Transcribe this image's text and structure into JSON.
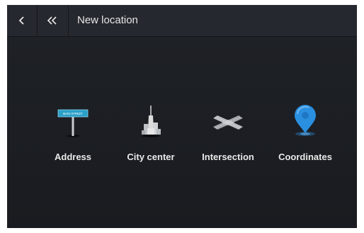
{
  "header": {
    "back_icon": "chevron-left-icon",
    "home_icon": "double-chevron-left-icon",
    "title": "New location"
  },
  "options": [
    {
      "label": "Address",
      "icon": "street-sign-icon",
      "sign_text": "MAIN STREET"
    },
    {
      "label": "City center",
      "icon": "city-tower-icon"
    },
    {
      "label": "Intersection",
      "icon": "crossroads-icon"
    },
    {
      "label": "Coordinates",
      "icon": "map-pin-icon"
    }
  ],
  "colors": {
    "background": "#1a1c21",
    "header": "#25282e",
    "accent": "#2b8fe0",
    "sign": "#2aa0c8"
  }
}
